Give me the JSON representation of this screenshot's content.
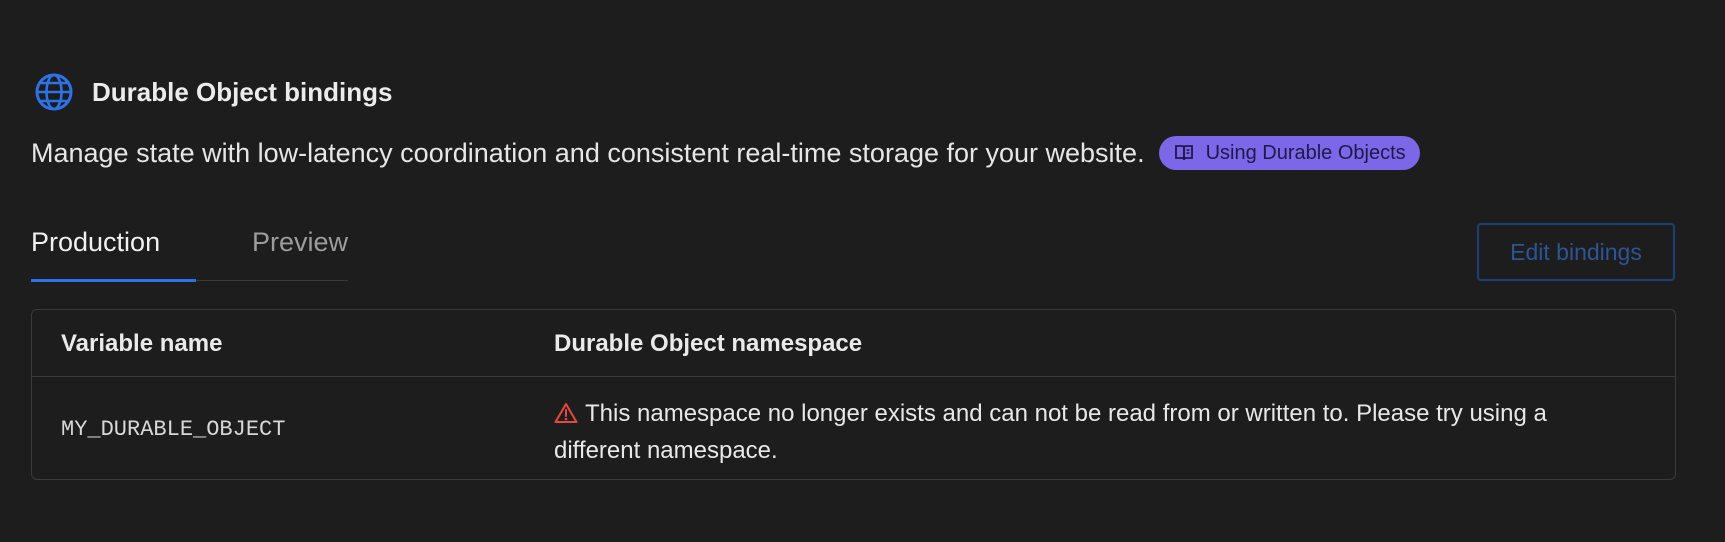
{
  "section": {
    "title": "Durable Object bindings",
    "description": "Manage state with low-latency coordination and consistent real-time storage for your website.",
    "doc_link_label": "Using Durable Objects",
    "icon": "globe-icon"
  },
  "tabs": [
    {
      "label": "Production",
      "active": true
    },
    {
      "label": "Preview",
      "active": false
    }
  ],
  "actions": {
    "edit_bindings_label": "Edit bindings"
  },
  "table": {
    "columns": [
      "Variable name",
      "Durable Object namespace"
    ],
    "rows": [
      {
        "variable_name": "MY_DURABLE_OBJECT",
        "namespace_warning": "This namespace no longer exists and can not be read from or written to. Please try using a different namespace."
      }
    ]
  },
  "colors": {
    "accent": "#2e72e8",
    "pill": "#7b67e8",
    "warning": "#e5483c",
    "background": "#1d1d1d"
  }
}
